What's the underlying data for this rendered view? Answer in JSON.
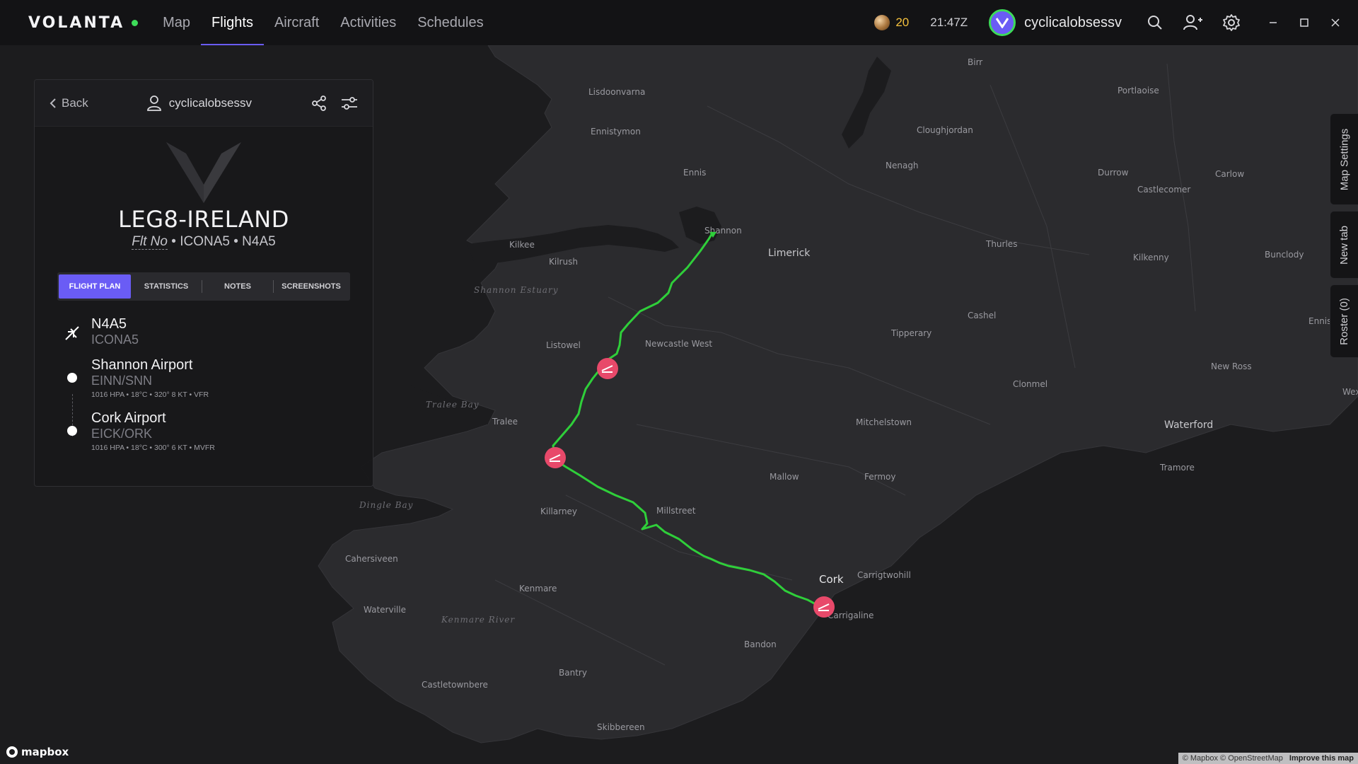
{
  "app": {
    "brand": "VOLANTA",
    "accent_color": "#6a5cf5",
    "online_color": "#3ddc59"
  },
  "nav": {
    "items": [
      {
        "label": "Map",
        "active": false
      },
      {
        "label": "Flights",
        "active": true
      },
      {
        "label": "Aircraft",
        "active": false
      },
      {
        "label": "Activities",
        "active": false
      },
      {
        "label": "Schedules",
        "active": false
      }
    ]
  },
  "topbar": {
    "credits": "20",
    "time": "21:47Z",
    "username": "cyclicalobsessv",
    "icons": [
      "search-icon",
      "friends-icon",
      "settings-icon",
      "minimize-icon",
      "maximize-icon",
      "close-icon"
    ]
  },
  "panel": {
    "back_label": "Back",
    "username": "cyclicalobsessv",
    "flight_title": "LEG8-IRELAND",
    "flt_no_label": "Flt No",
    "callsign": "ICONA5",
    "registration": "N4A5",
    "tabs": [
      "FLIGHT PLAN",
      "STATISTICS",
      "NOTES",
      "SCREENSHOTS"
    ],
    "active_tab": "FLIGHT PLAN",
    "aircraft": {
      "reg": "N4A5",
      "callsign": "ICONA5"
    },
    "departure": {
      "name": "Shannon Airport",
      "code": "EINN/SNN",
      "wx": "1016 HPA • 18°C • 320° 8 KT • VFR"
    },
    "arrival": {
      "name": "Cork Airport",
      "code": "EICK/ORK",
      "wx": "1016 HPA • 18°C • 300° 6 KT • MVFR"
    }
  },
  "side_tabs": [
    "Map Settings",
    "New tab",
    "Roster (0)"
  ],
  "map": {
    "route_color": "#2fcf3a",
    "marker_color": "#e8496a",
    "places": [
      {
        "name": "Birr",
        "cls": "town"
      },
      {
        "name": "Lisdoonvarna",
        "cls": "town"
      },
      {
        "name": "Portlaoise",
        "cls": "town"
      },
      {
        "name": "Ennistymon",
        "cls": "town"
      },
      {
        "name": "Cloughjordan",
        "cls": "town"
      },
      {
        "name": "Nenagh",
        "cls": "town"
      },
      {
        "name": "Durrow",
        "cls": "town"
      },
      {
        "name": "Carlow",
        "cls": "town"
      },
      {
        "name": "Ennis",
        "cls": "town"
      },
      {
        "name": "Castlecomer",
        "cls": "town"
      },
      {
        "name": "Shannon",
        "cls": "town"
      },
      {
        "name": "Kilkee",
        "cls": "town"
      },
      {
        "name": "Limerick",
        "cls": "town major"
      },
      {
        "name": "Thurles",
        "cls": "town"
      },
      {
        "name": "Kilkenny",
        "cls": "town"
      },
      {
        "name": "Bunclody",
        "cls": "town"
      },
      {
        "name": "Kilrush",
        "cls": "town"
      },
      {
        "name": "Cashel",
        "cls": "town"
      },
      {
        "name": "Listowel",
        "cls": "town"
      },
      {
        "name": "Newcastle West",
        "cls": "town"
      },
      {
        "name": "Tipperary",
        "cls": "town"
      },
      {
        "name": "Enniscorthy",
        "cls": "town"
      },
      {
        "name": "New Ross",
        "cls": "town"
      },
      {
        "name": "Clonmel",
        "cls": "town"
      },
      {
        "name": "Wexford",
        "cls": "town"
      },
      {
        "name": "Tralee",
        "cls": "town"
      },
      {
        "name": "Mitchelstown",
        "cls": "town"
      },
      {
        "name": "Waterford",
        "cls": "town major"
      },
      {
        "name": "Tramore",
        "cls": "town"
      },
      {
        "name": "Mallow",
        "cls": "town"
      },
      {
        "name": "Fermoy",
        "cls": "town"
      },
      {
        "name": "Killarney",
        "cls": "town"
      },
      {
        "name": "Millstreet",
        "cls": "town"
      },
      {
        "name": "Cahersiveen",
        "cls": "town"
      },
      {
        "name": "Cork",
        "cls": "town city"
      },
      {
        "name": "Carrigtwohill",
        "cls": "town"
      },
      {
        "name": "Kenmare",
        "cls": "town"
      },
      {
        "name": "Waterville",
        "cls": "town"
      },
      {
        "name": "Carrigaline",
        "cls": "town"
      },
      {
        "name": "Bandon",
        "cls": "town"
      },
      {
        "name": "Bantry",
        "cls": "town"
      },
      {
        "name": "Castletownbere",
        "cls": "town"
      },
      {
        "name": "Skibbereen",
        "cls": "town"
      }
    ],
    "water_labels": [
      "Shannon Estuary",
      "Tralee Bay",
      "Dingle Bay",
      "Kenmare River"
    ],
    "attribution_prefix": "© Mapbox © OpenStreetMap",
    "attribution_link": "Improve this map",
    "logo_text": "mapbox"
  }
}
